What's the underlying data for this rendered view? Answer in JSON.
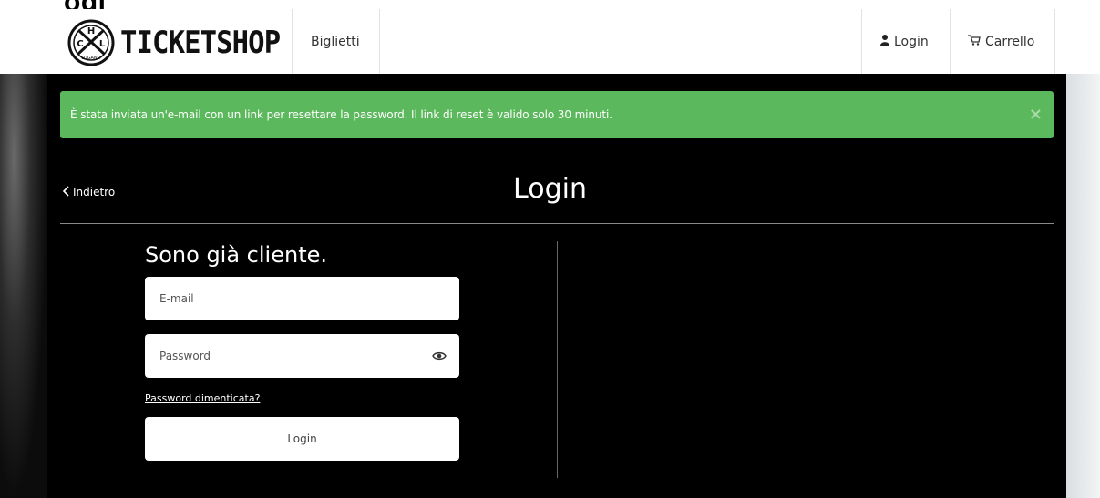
{
  "page_fragment": "ogi",
  "brand": {
    "name": "TICKETSHOP",
    "logo_letters": "CHL",
    "logo_caption": "LUGANO"
  },
  "nav": {
    "tickets_label": "Biglietti",
    "login_label": "Login",
    "cart_label": "Carrello"
  },
  "alert": {
    "message": "È stata inviata un'e-mail con un link per resettare la password. Il link di reset è valido solo 30 minuti.",
    "close_symbol": "×",
    "color": "#5cb85c"
  },
  "header": {
    "back_label": "Indietro",
    "title": "Login"
  },
  "form": {
    "heading": "Sono già cliente.",
    "email_placeholder": "E-mail",
    "password_placeholder": "Password",
    "forgot_label": "Password dimenticata?",
    "submit_label": "Login"
  },
  "icons": {
    "user": "user-icon",
    "cart": "cart-icon",
    "eye": "eye-icon",
    "back": "chevron-left-icon",
    "close": "close-icon"
  }
}
